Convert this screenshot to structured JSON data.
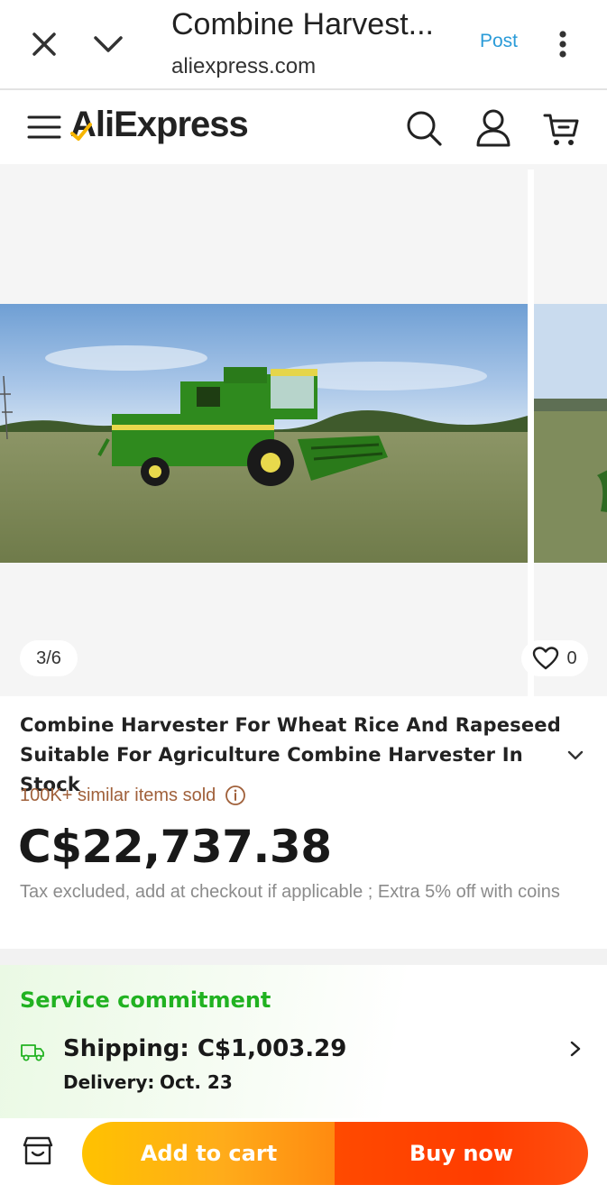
{
  "browser": {
    "title": "Combine Harvest...",
    "url": "aliexpress.com",
    "post_label": "Post",
    "icons": [
      "close-icon",
      "chevron-down-icon",
      "more-vertical-icon"
    ]
  },
  "header": {
    "logo_text": "AliExpress",
    "icons": [
      "menu-icon",
      "search-icon",
      "user-icon",
      "cart-icon"
    ]
  },
  "gallery": {
    "counter": "3/6",
    "wishlist_count": "0",
    "image_description_icon": "combine-harvester-photo"
  },
  "product": {
    "title": "Combine Harvester For Wheat Rice And Rapeseed Suitable For Agriculture Combine Harvester In Stock",
    "sold_text": "100K+ similar items sold",
    "price": "C$22,737.38",
    "tax_note": "Tax excluded, add at checkout if applicable ; Extra 5% off with coins"
  },
  "service": {
    "title": "Service commitment",
    "shipping": "Shipping: C$1,003.29",
    "delivery_label": "Delivery:",
    "delivery_date": "Oct. 23"
  },
  "actions": {
    "add_to_cart": "Add to cart",
    "buy_now": "Buy now"
  },
  "colors": {
    "link_blue": "#2a9bd8",
    "sold_brown": "#a0603a",
    "service_green": "#21b221",
    "cart_orange": "#ffac1a",
    "buy_red": "#ff3c00"
  }
}
